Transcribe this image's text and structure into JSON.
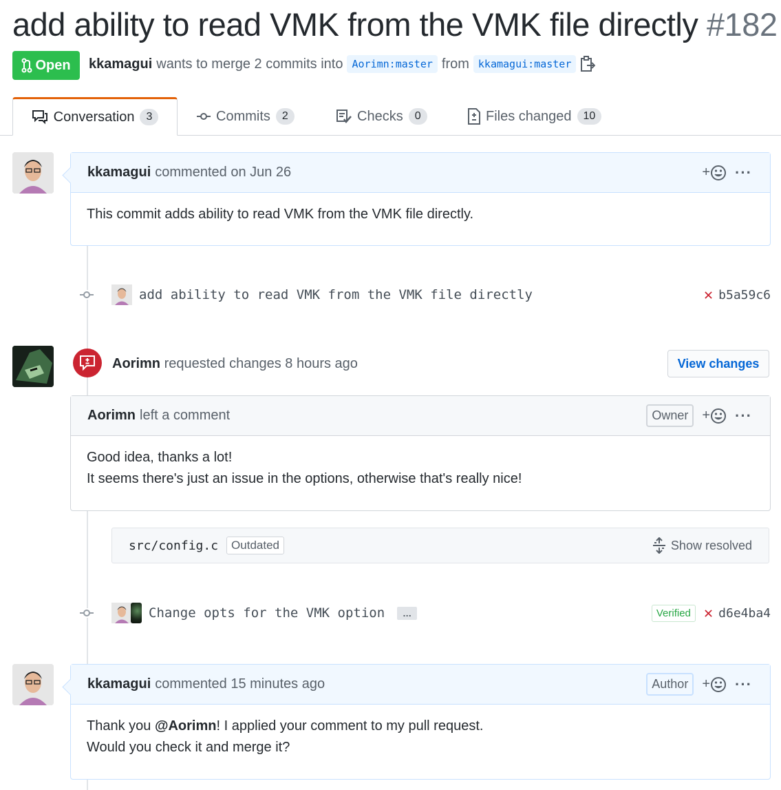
{
  "pr": {
    "title": "add ability to read VMK from the VMK file directly",
    "number": "#182",
    "state": "Open",
    "author": "kkamagui",
    "merge_text": "wants to merge 2 commits into",
    "base_ref": "Aorimn:master",
    "from_text": "from",
    "head_ref": "kkamagui:master"
  },
  "tabs": [
    {
      "label": "Conversation",
      "count": "3"
    },
    {
      "label": "Commits",
      "count": "2"
    },
    {
      "label": "Checks",
      "count": "0"
    },
    {
      "label": "Files changed",
      "count": "10"
    }
  ],
  "comment1": {
    "author": "kkamagui",
    "meta": "commented on Jun 26",
    "body": "This commit adds ability to read VMK from the VMK file directly."
  },
  "commit1": {
    "message": "add ability to read VMK from the VMK file directly",
    "sha": "b5a59c6"
  },
  "review": {
    "author": "Aorimn",
    "action": "requested changes",
    "time": "8 hours ago",
    "button": "View changes"
  },
  "comment2": {
    "author": "Aorimn",
    "meta": "left a comment",
    "badge": "Owner",
    "body_line1": "Good idea, thanks a lot!",
    "body_line2": "It seems there's just an issue in the options, otherwise that's really nice!"
  },
  "file_thread": {
    "file": "src/config.c",
    "outdated": "Outdated",
    "show_resolved": "Show resolved"
  },
  "commit2": {
    "message": "Change opts for the VMK option",
    "ellipsis": "…",
    "verified": "Verified",
    "sha": "d6e4ba4"
  },
  "comment3": {
    "author": "kkamagui",
    "meta": "commented 15 minutes ago",
    "badge": "Author",
    "body_pre": "Thank you ",
    "mention": "@Aorimn",
    "body_post": "! I applied your comment to my pull request.",
    "body_line2": "Would you check it and merge it?"
  },
  "icons": {
    "add_reaction": "+",
    "more": "···"
  },
  "colors": {
    "open_green": "#2cbe4e",
    "link_blue": "#0366d6",
    "changes_red": "#cb2431",
    "tab_accent": "#e36209"
  }
}
